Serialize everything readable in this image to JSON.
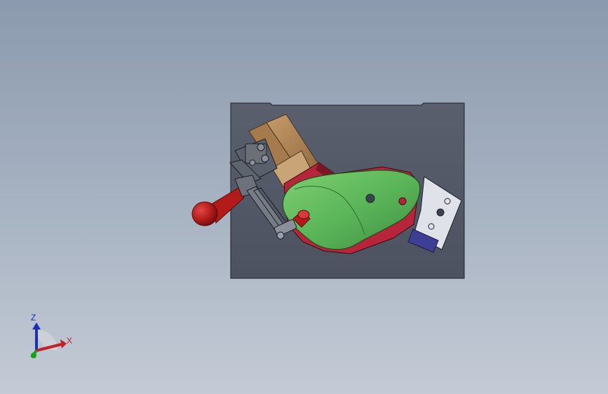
{
  "viewport": {
    "background_top": "#8b9aae",
    "background_bottom": "#c4cbd6"
  },
  "model": {
    "base_plate_color": "#545a68",
    "wood_block_color": "#b58a5c",
    "green_part_color": "#5bb65a",
    "red_part_color": "#b6253a",
    "clamp_handle_color": "#b31b1b",
    "metal_color": "#6a6f78",
    "blue_block_color": "#3d3f95"
  },
  "triad": {
    "x_label": "X",
    "z_label": "Z",
    "x_color": "#c21f2b",
    "y_color": "#16a016",
    "z_color": "#1a2fb8"
  }
}
